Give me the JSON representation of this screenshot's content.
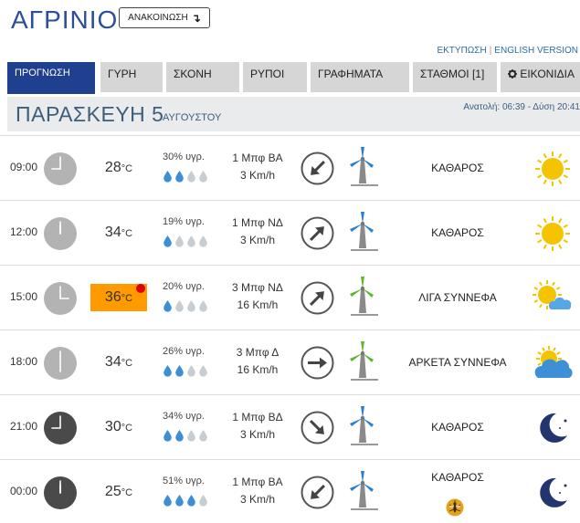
{
  "header": {
    "city": "ΑΓΡΙΝΙΟ",
    "announce_label": "ΑΝΑΚΟΙΝΩΣΗ",
    "announce_icon": "↴",
    "print_link": "ΕΚΤΥΠΩΣΗ",
    "separator": "|",
    "english_link": "ENGLISH VERSION"
  },
  "tabs": [
    {
      "label": "ΠΡΟΓΝΩΣΗ",
      "active": true
    },
    {
      "label": "ΓΥΡΗ"
    },
    {
      "label": "ΣΚΟΝΗ"
    },
    {
      "label": "ΡΥΠΟΙ"
    },
    {
      "label": "ΓΡΑΦΗΜΑΤΑ"
    },
    {
      "label": "ΣΤΑΘΜΟΙ [1]"
    },
    {
      "label": "ΕΙΚΟΝΙΔΙΑ",
      "icon": "gear-icon"
    }
  ],
  "day": {
    "title": "ΠΑΡΑΣΚΕΥΗ 5",
    "month": "ΑΥΓΟΥΣΤΟΥ",
    "sun": "Ανατολή: 06:39 - Δύση 20:41"
  },
  "temp_unit": "°C",
  "colors": {
    "accent": "#1f3f8f",
    "hot_temp": "#ff9a00",
    "alert_dot": "#e00000",
    "drop_filled": "#3a8fd6",
    "drop_empty": "#c8cdd2",
    "clock_day": "#b3b3b3",
    "clock_night": "#4a4a4a",
    "sun": "#f5c400",
    "moon": "#23356e"
  },
  "rows": [
    {
      "time": "09:00",
      "hour": 9,
      "night": false,
      "temp": "28",
      "hot": false,
      "humidity": "30% υγρ.",
      "drops": 2,
      "wind_force": "1 Μπφ ΒΑ",
      "wind_speed": "3 Km/h",
      "wind_arrow": "arrow-down-left",
      "wind_angle": 225,
      "turbine_color": "#2a7fcf",
      "condition": "ΚΑΘΑΡΟΣ",
      "icon": "sun-icon"
    },
    {
      "time": "12:00",
      "hour": 12,
      "night": false,
      "temp": "34",
      "hot": false,
      "humidity": "19% υγρ.",
      "drops": 1,
      "wind_force": "1 Μπφ ΝΔ",
      "wind_speed": "3 Km/h",
      "wind_arrow": "arrow-up-right",
      "wind_angle": 45,
      "turbine_color": "#2a7fcf",
      "condition": "ΚΑΘΑΡΟΣ",
      "icon": "sun-icon"
    },
    {
      "time": "15:00",
      "hour": 15,
      "night": false,
      "temp": "36",
      "hot": true,
      "humidity": "20% υγρ.",
      "drops": 1,
      "wind_force": "3 Μπφ ΝΔ",
      "wind_speed": "16 Km/h",
      "wind_arrow": "arrow-up-right",
      "wind_angle": 45,
      "turbine_color": "#5cb82c",
      "condition": "ΛΙΓΑ ΣΥΝΝΕΦΑ",
      "icon": "sun-cloud-icon"
    },
    {
      "time": "18:00",
      "hour": 18,
      "night": false,
      "temp": "34",
      "hot": false,
      "humidity": "26% υγρ.",
      "drops": 2,
      "wind_force": "3 Μπφ Δ",
      "wind_speed": "16 Km/h",
      "wind_arrow": "arrow-right",
      "wind_angle": 0,
      "turbine_color": "#5cb82c",
      "condition": "ΑΡΚΕΤΑ ΣΥΝΝΕΦΑ",
      "icon": "cloud-sun-icon"
    },
    {
      "time": "21:00",
      "hour": 21,
      "night": true,
      "temp": "30",
      "hot": false,
      "humidity": "34% υγρ.",
      "drops": 2,
      "wind_force": "1 Μπφ ΒΔ",
      "wind_speed": "3 Km/h",
      "wind_arrow": "arrow-down-right",
      "wind_angle": 315,
      "turbine_color": "#2a7fcf",
      "condition": "ΚΑΘΑΡΟΣ",
      "icon": "moon-icon"
    },
    {
      "time": "00:00",
      "hour": 0,
      "night": true,
      "temp": "25",
      "hot": false,
      "humidity": "51% υγρ.",
      "drops": 3,
      "wind_force": "1 Μπφ ΒΑ",
      "wind_speed": "3 Km/h",
      "wind_arrow": "arrow-down-left",
      "wind_angle": 225,
      "turbine_color": "#2a7fcf",
      "condition": "ΚΑΘΑΡΟΣ",
      "icon": "moon-icon",
      "mosquito": true
    }
  ]
}
